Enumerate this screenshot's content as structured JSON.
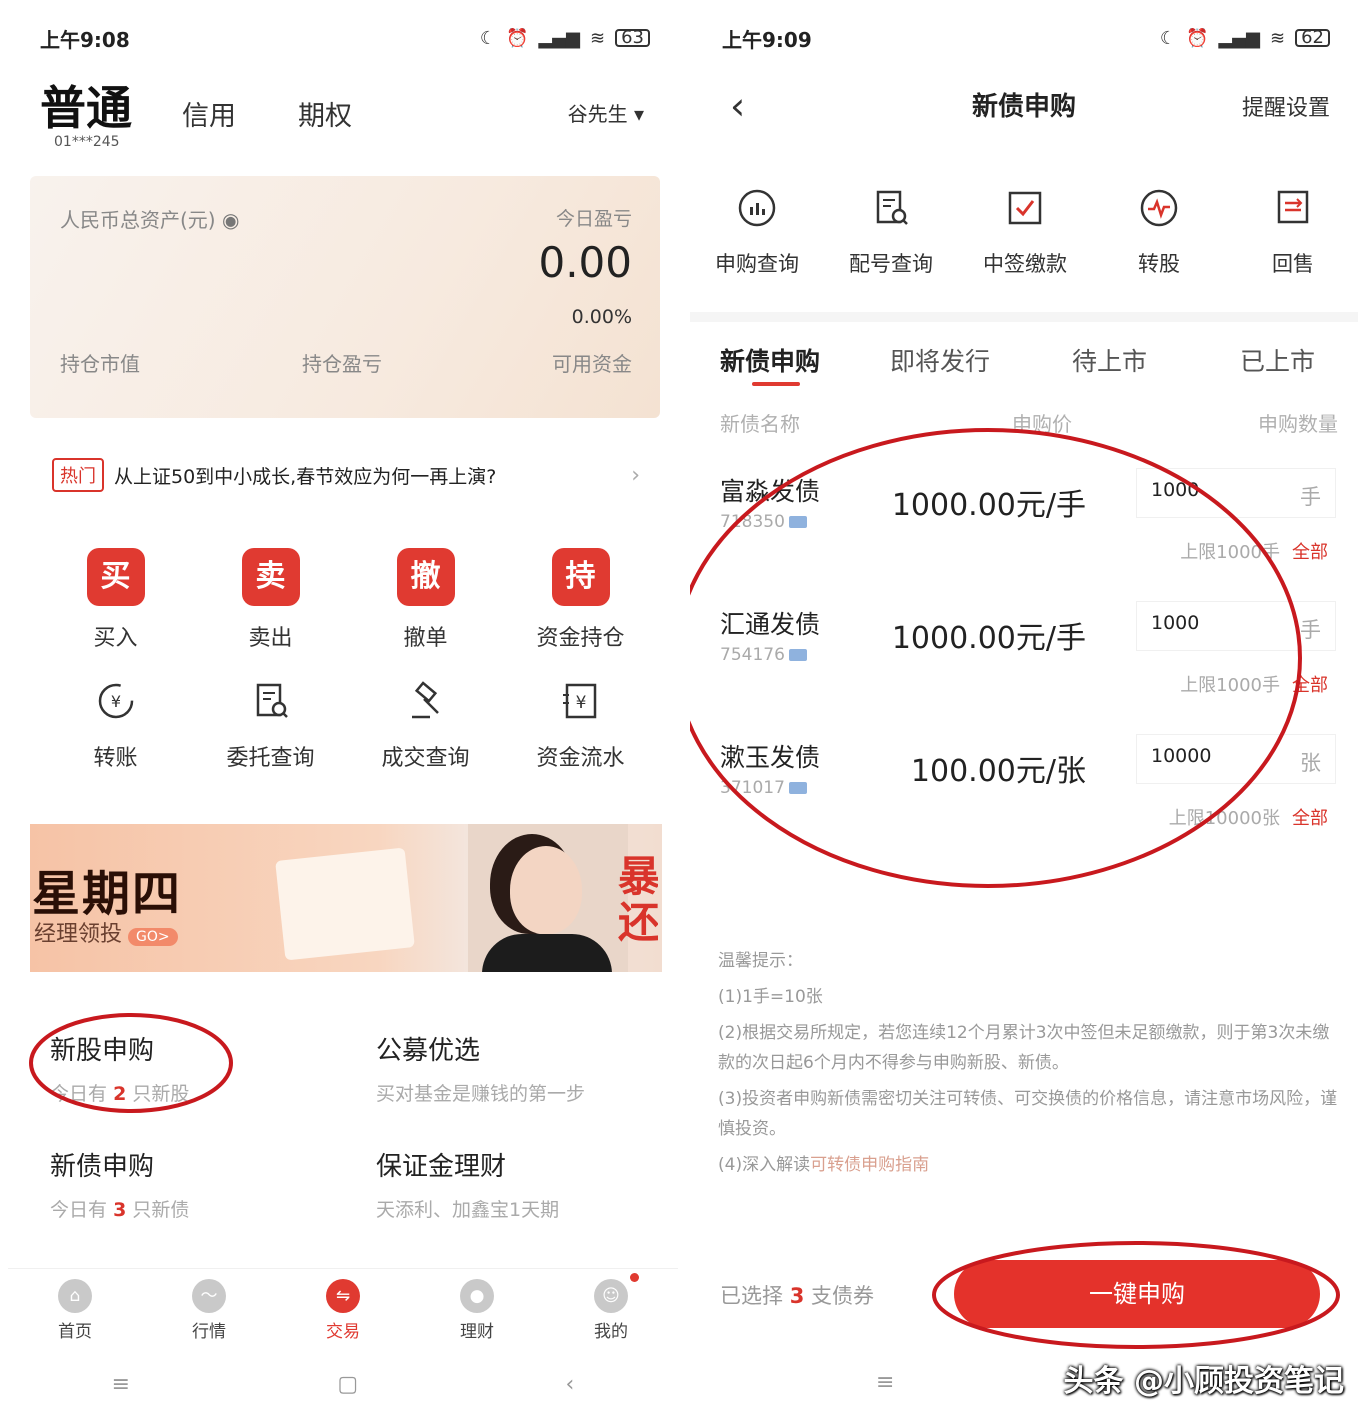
{
  "left": {
    "status": {
      "time": "上午9:08",
      "battery": "63"
    },
    "header": {
      "active_tab": "普通",
      "account_id": "01***245",
      "tabs": [
        "信用",
        "期权"
      ],
      "user": "谷先生 ▾"
    },
    "asset": {
      "label": "人民币总资产(元)",
      "today_label": "今日盈亏",
      "today_value": "0.00",
      "today_pct": "0.00%",
      "foot": [
        "持仓市值",
        "持仓盈亏",
        "可用资金"
      ]
    },
    "news": {
      "badge": "热门",
      "text": "从上证50到中小成长,春节效应为何一再上演?",
      "arrow": "›"
    },
    "quick": [
      {
        "badge": "买",
        "label": "买入"
      },
      {
        "badge": "卖",
        "label": "卖出"
      },
      {
        "badge": "撤",
        "label": "撤单"
      },
      {
        "badge": "持",
        "label": "资金持仓"
      },
      {
        "label": "转账"
      },
      {
        "label": "委托查询"
      },
      {
        "label": "成交查询"
      },
      {
        "label": "资金流水"
      }
    ],
    "banner": {
      "title": "星期四",
      "sub": "经理领投",
      "go": "GO>",
      "right": "暴还"
    },
    "features": [
      {
        "title": "新股申购",
        "sub_pre": "今日有",
        "count": "2",
        "sub_post": "只新股"
      },
      {
        "title": "公募优选",
        "sub": "买对基金是赚钱的第一步"
      },
      {
        "title": "新债申购",
        "sub_pre": "今日有",
        "count": "3",
        "sub_post": "只新债"
      },
      {
        "title": "保证金理财",
        "sub": "天添利、加鑫宝1天期"
      }
    ],
    "tabbar": [
      "首页",
      "行情",
      "交易",
      "理财",
      "我的"
    ]
  },
  "right": {
    "status": {
      "time": "上午9:09",
      "battery": "62"
    },
    "header": {
      "title": "新债申购",
      "remind": "提醒设置"
    },
    "tools": [
      "申购查询",
      "配号查询",
      "中签缴款",
      "转股",
      "回售"
    ],
    "tabs": [
      "新债申购",
      "即将发行",
      "待上市",
      "已上市"
    ],
    "columns": [
      "新债名称",
      "申购价",
      "申购数量"
    ],
    "bonds": [
      {
        "name": "富淼发债",
        "code": "718350",
        "price": "1000.00元/手",
        "qty": "1000",
        "unit": "手",
        "limit": "上限1000手",
        "all": "全部"
      },
      {
        "name": "汇通发债",
        "code": "754176",
        "price": "1000.00元/手",
        "qty": "1000",
        "unit": "手",
        "limit": "上限1000手",
        "all": "全部"
      },
      {
        "name": "漱玉发债",
        "code": "371017",
        "price": "100.00元/张",
        "qty": "10000",
        "unit": "张",
        "limit": "上限10000张",
        "all": "全部"
      }
    ],
    "tips": {
      "title": "温馨提示：",
      "items": [
        "(1)1手=10张",
        "(2)根据交易所规定，若您连续12个月累计3次中签但未足额缴款，则于第3次未缴款的次日起6个月内不得参与申购新股、新债。",
        "(3)投资者申购新债需密切关注可转债、可交换债的价格信息，请注意市场风险，谨慎投资。"
      ],
      "last_pre": "(4)深入解读",
      "last_link": "可转债申购指南"
    },
    "bottom": {
      "selected_pre": "已选择",
      "selected_count": "3",
      "selected_post": "支债券",
      "button": "一键申购"
    },
    "watermark": "头条 @小顾投资笔记"
  },
  "colors": {
    "accent": "#e03a31",
    "annotation": "#c8191e"
  }
}
